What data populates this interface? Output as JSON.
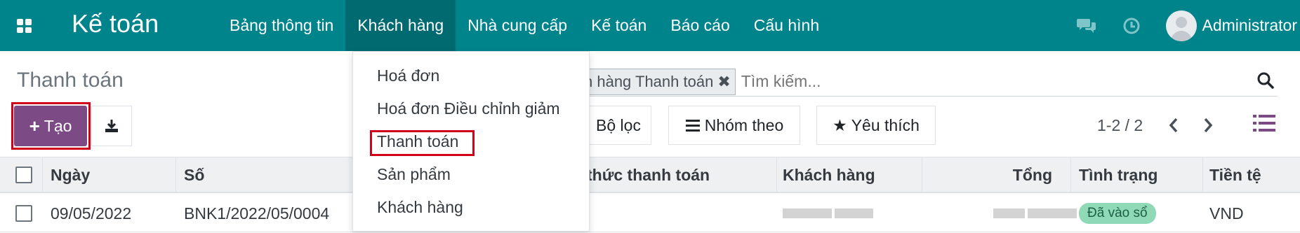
{
  "app": {
    "title": "Kế toán"
  },
  "navbar": {
    "menu": [
      "Bảng thông tin",
      "Khách hàng",
      "Nhà cung cấp",
      "Kế toán",
      "Báo cáo",
      "Cấu hình"
    ],
    "active_index": 1,
    "user_name": "Administrator",
    "icons": [
      "apps-grid-icon",
      "chat-icon",
      "clock-icon",
      "avatar"
    ]
  },
  "breadcrumb": "Thanh toán",
  "search": {
    "facet_label": "Khách hàng Thanh toán",
    "facet_visible_text": "ch hàng Thanh toán",
    "placeholder": "Tìm kiếm..."
  },
  "toolbar": {
    "create_label": "Tạo",
    "filter_label": "Bộ lọc",
    "group_label": "Nhóm theo",
    "favorite_label": "Yêu thích"
  },
  "pager": {
    "text": "1-2 / 2"
  },
  "dropdown": {
    "items": [
      "Hoá đơn",
      "Hoá đơn Điều chỉnh giảm",
      "Thanh toán",
      "Sản phẩm",
      "Khách hàng"
    ],
    "highlighted_index": 2
  },
  "table": {
    "headers": {
      "date": "Ngày",
      "number": "Số",
      "method": "thức thanh toán",
      "customer": "Khách hàng",
      "total": "Tổng",
      "status": "Tình trạng",
      "currency": "Tiền tệ"
    },
    "rows": [
      {
        "date": "09/05/2022",
        "number": "BNK1/2022/05/0004",
        "method": "",
        "customer": "",
        "total": "",
        "status": "Đã vào sổ",
        "currency": "VND"
      }
    ]
  },
  "colors": {
    "navbar": "#00848c",
    "navbar_active": "#006a71",
    "primary_button": "#7c4a85",
    "highlight_box": "#d0021b",
    "status_badge": "#8fd9b6"
  }
}
